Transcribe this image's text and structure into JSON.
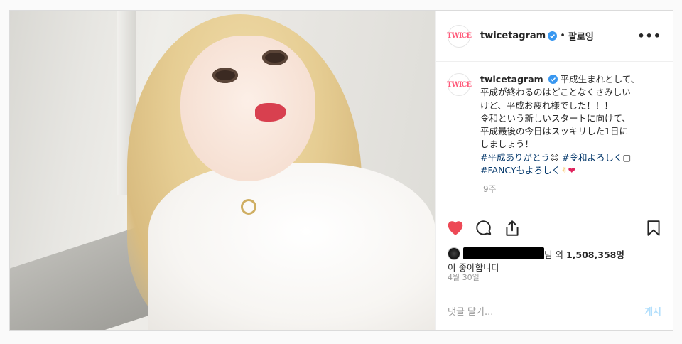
{
  "header": {
    "username": "twicetagram",
    "avatar_text": "TWICE",
    "separator": "•",
    "follow_label": "팔로잉",
    "more_label": "•••"
  },
  "caption": {
    "username": "twicetagram",
    "lines": [
      "平成生まれとして、",
      "平成が終わるのはどことなくさみしい",
      "けど、平成お疲れ様でした！！！",
      "令和という新しいスタートに向けて、",
      "平成最後の今日はスッキリした1日に",
      "しましょう！"
    ],
    "tag1": "#平成ありがとう",
    "emoji1": "😊",
    "tag2": "#令和よろしく",
    "emoji2": "▢",
    "tag3": "#FANCYもよろしく",
    "emoji3": "✌",
    "emoji4": "❤",
    "time": "9주"
  },
  "icons": [
    "heart-icon",
    "comment-icon",
    "share-icon",
    "bookmark-icon"
  ],
  "likes": {
    "suffix": "님 외 ",
    "count": "1,508,358명",
    "line2": "이 좋아합니다"
  },
  "date": "4월 30일",
  "comment_box": {
    "placeholder": "댓글 달기...",
    "post_label": "게시"
  },
  "colors": {
    "like_red": "#ed4956",
    "hashtag": "#003569",
    "verified_blue": "#3897f0",
    "post_disabled": "#b2dffc"
  }
}
